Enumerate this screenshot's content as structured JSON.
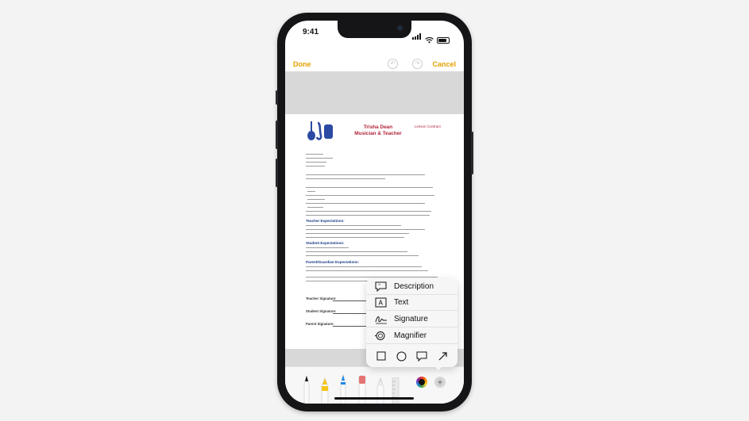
{
  "status_bar": {
    "time": "9:41"
  },
  "nav": {
    "done": "Done",
    "cancel": "Cancel"
  },
  "document": {
    "title_line1": "Trisha Dean",
    "title_line2": "Musician & Teacher",
    "tag": "Lesson Contract",
    "sections": [
      "Teacher Expectations:",
      "Student Expectations:",
      "Parent/Guardian Expectations:"
    ],
    "signatures": [
      "Teacher Signature:",
      "Student Signature:",
      "Parent Signature:"
    ]
  },
  "menu": {
    "items": [
      {
        "label": "Description",
        "icon": "speech-quote-icon"
      },
      {
        "label": "Text",
        "icon": "text-box-icon"
      },
      {
        "label": "Signature",
        "icon": "signature-icon"
      },
      {
        "label": "Magnifier",
        "icon": "magnifier-icon"
      }
    ],
    "shapes": [
      "square-icon",
      "circle-icon",
      "speech-bubble-icon",
      "arrow-icon"
    ]
  },
  "tools": [
    "pen",
    "marker",
    "pencil",
    "eraser",
    "lasso",
    "ruler"
  ],
  "colors": {
    "accent": "#e6a200",
    "doc_red": "#b0243a",
    "doc_blue": "#2b4aa3"
  }
}
